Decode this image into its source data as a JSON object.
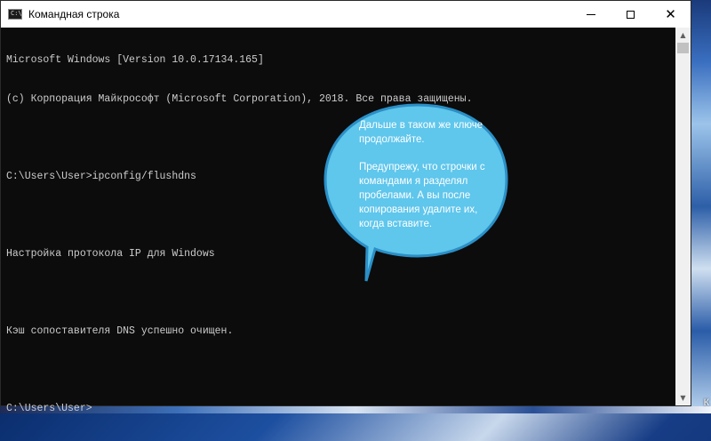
{
  "window": {
    "title": "Командная строка",
    "icon_label": "C:\\",
    "controls": {
      "minimize": "minimize-icon",
      "maximize": "maximize-icon",
      "close": "close-icon",
      "close_glyph": "✕"
    }
  },
  "console": {
    "lines": [
      "Microsoft Windows [Version 10.0.17134.165]",
      "(c) Корпорация Майкрософт (Microsoft Corporation), 2018. Все права защищены.",
      "",
      "C:\\Users\\User>ipconfig/flushdns",
      "",
      "Настройка протокола IP для Windows",
      "",
      "Кэш сопоставителя DNS успешно очищен.",
      "",
      "C:\\Users\\User>"
    ]
  },
  "scrollbar": {
    "up_glyph": "▲",
    "down_glyph": "▼"
  },
  "callout": {
    "paragraph1": "Дальше в таком же ключе продолжайте.",
    "paragraph2": "Предупрежу, что строчки с командами я разделял пробелами. А вы после копирования удалите их, когда вставите.",
    "fill_color": "#5fc6ec",
    "stroke_color": "#2b8fc6"
  },
  "desktop": {
    "label": "К"
  }
}
